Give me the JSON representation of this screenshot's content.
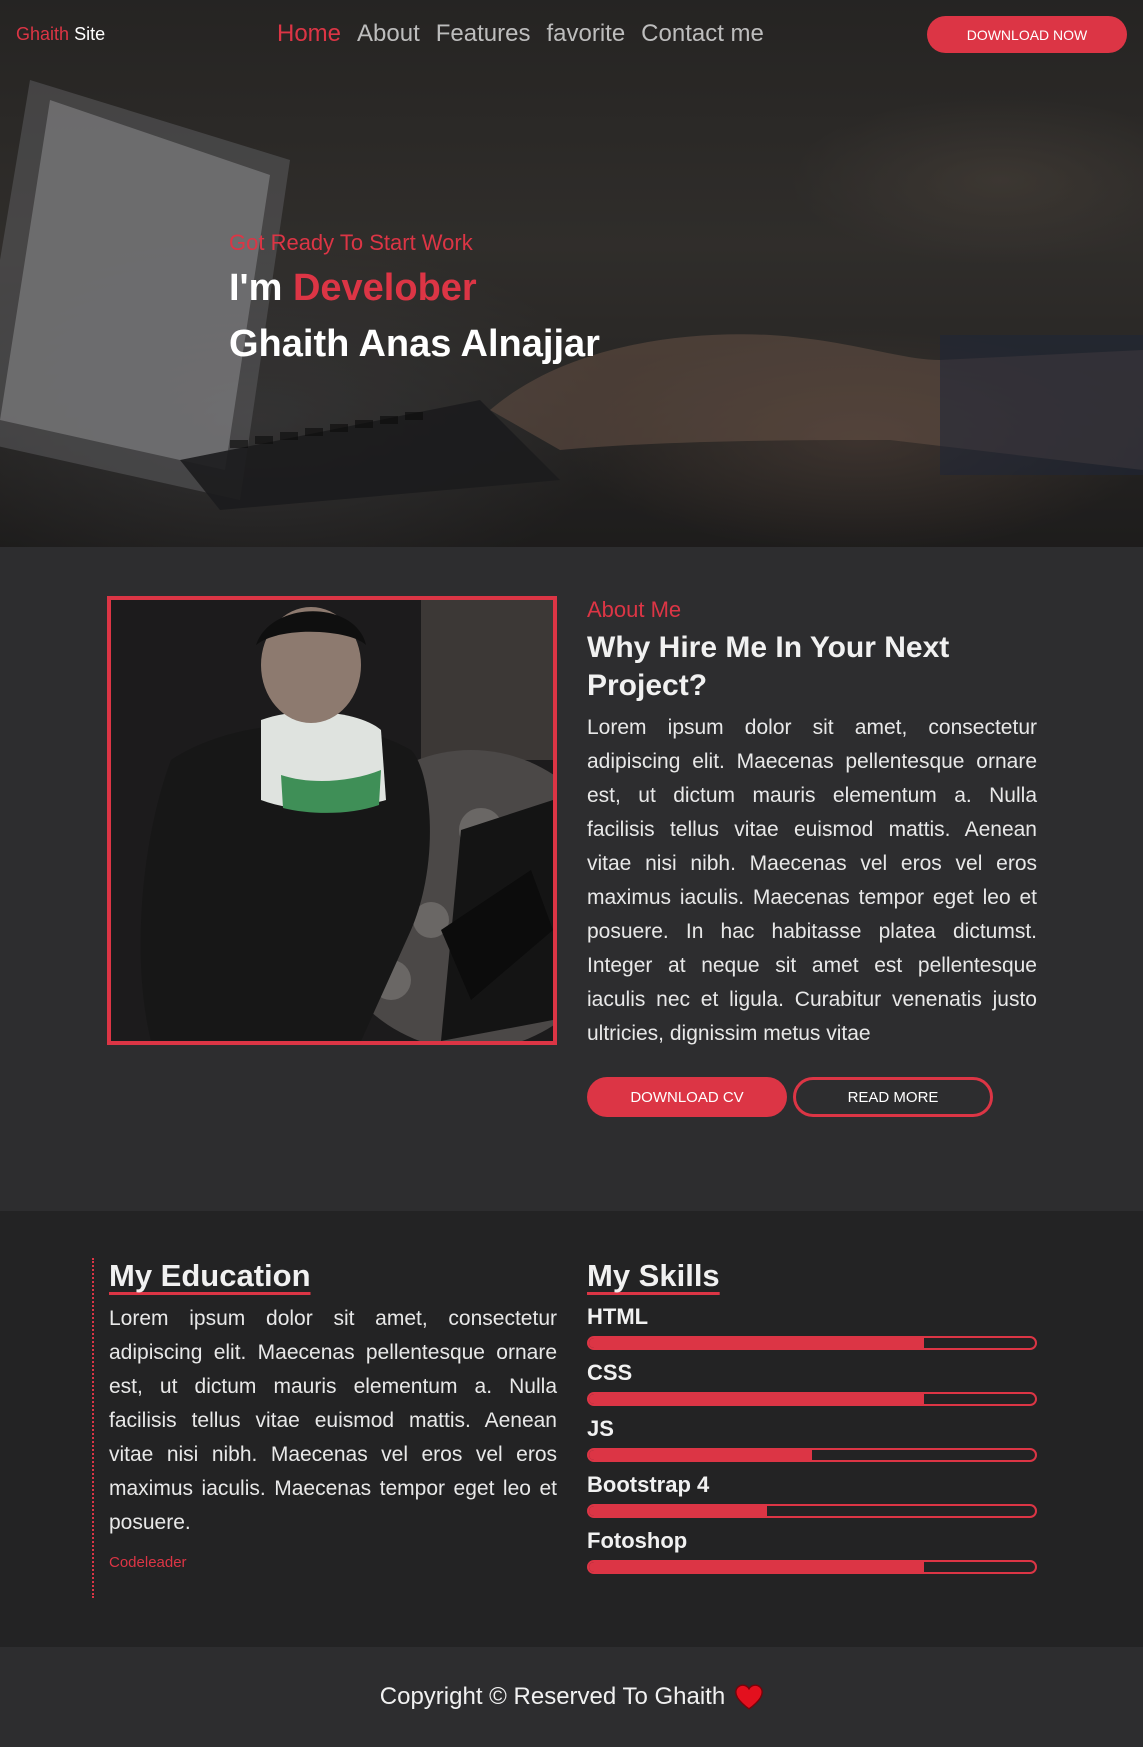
{
  "header": {
    "brand_part1": "Ghaith",
    "brand_part2": "Site",
    "nav": [
      "Home",
      "About",
      "Features",
      "favorite",
      "Contact me"
    ],
    "download_label": "DOWNLOAD NOW"
  },
  "hero": {
    "subtitle": "Got Ready To Start Work",
    "title_prefix": "I'm",
    "title_accent": "Develober",
    "name": "Ghaith Anas Alnajjar"
  },
  "about": {
    "label": "About Me",
    "heading": "Why Hire Me In Your Next Project?",
    "text": "Lorem ipsum dolor sit amet, consectetur adipiscing elit. Maecenas pellentesque ornare est, ut dictum mauris elementum a. Nulla facilisis tellus vitae euismod mattis. Aenean vitae nisi nibh. Maecenas vel eros vel eros maximus iaculis. Maecenas tempor eget leo et posuere. In hac habitasse platea dictumst. Integer at neque sit amet est pellentesque iaculis nec et ligula. Curabitur venenatis justo ultricies, dignissim metus vitae",
    "cv_label": "DOWNLOAD CV",
    "more_label": "READ MORE"
  },
  "education": {
    "title": "My Education",
    "text": "Lorem ipsum dolor sit amet, consectetur adipiscing elit. Maecenas pellentesque ornare est, ut dictum mauris elementum a. Nulla facilisis tellus vitae euismod mattis. Aenean vitae nisi nibh. Maecenas vel eros vel eros maximus iaculis. Maecenas tempor eget leo et posuere.",
    "source": "Codeleader"
  },
  "skills": {
    "title": "My Skills",
    "items": [
      {
        "name": "HTML",
        "percent": 75
      },
      {
        "name": "CSS",
        "percent": 75
      },
      {
        "name": "JS",
        "percent": 50
      },
      {
        "name": "Bootstrap 4",
        "percent": 40
      },
      {
        "name": "Fotoshop",
        "percent": 75
      }
    ]
  },
  "footer": {
    "text": "Copyright © Reserved To Ghaith"
  },
  "colors": {
    "accent": "#dc3545",
    "dark_bg": "#2d2d2f",
    "darker_bg": "#232324"
  }
}
